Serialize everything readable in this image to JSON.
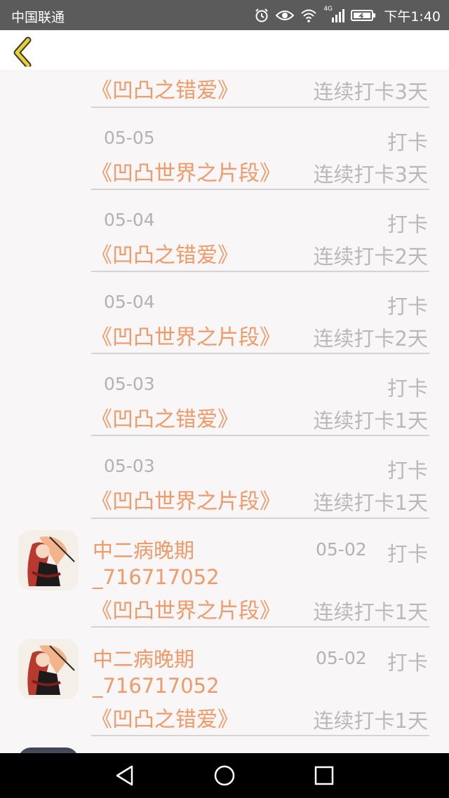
{
  "status_bar": {
    "carrier": "中国联通",
    "time": "下午1:40",
    "network_badge": "4G"
  },
  "header": {
    "back_icon": "chevron-left-icon"
  },
  "records": [
    {
      "date": "",
      "action": "",
      "book": "《凹凸之错爱》",
      "streak": "连续打卡3天"
    },
    {
      "date": "05-05",
      "action": "打卡",
      "book": "《凹凸世界之片段》",
      "streak": "连续打卡3天"
    },
    {
      "date": "05-04",
      "action": "打卡",
      "book": "《凹凸之错爱》",
      "streak": "连续打卡2天"
    },
    {
      "date": "05-04",
      "action": "打卡",
      "book": "《凹凸世界之片段》",
      "streak": "连续打卡2天"
    },
    {
      "date": "05-03",
      "action": "打卡",
      "book": "《凹凸之错爱》",
      "streak": "连续打卡1天"
    },
    {
      "date": "05-03",
      "action": "打卡",
      "book": "《凹凸世界之片段》",
      "streak": "连续打卡1天"
    },
    {
      "username_line1": "中二病晚期",
      "username_line2": "_716717052",
      "date": "05-02",
      "action": "打卡",
      "book": "《凹凸世界之片段》",
      "streak": "连续打卡1天"
    },
    {
      "username_line1": "中二病晚期",
      "username_line2": "_716717052",
      "date": "05-02",
      "action": "打卡",
      "book": "《凹凸之错爱》",
      "streak": "连续打卡1天"
    }
  ],
  "colors": {
    "status_bar": "#5b5b5b",
    "header": "#ffffff",
    "background": "#f8f6f6",
    "book_title": "#ef9a68",
    "secondary_text": "#b9b9b9",
    "divider": "#d4d4d4",
    "back_icon": "#e8cf3a",
    "nav_bar": "#000000"
  },
  "nav_bar": {
    "icons": [
      "back-triangle-icon",
      "home-circle-icon",
      "recents-square-icon"
    ]
  }
}
